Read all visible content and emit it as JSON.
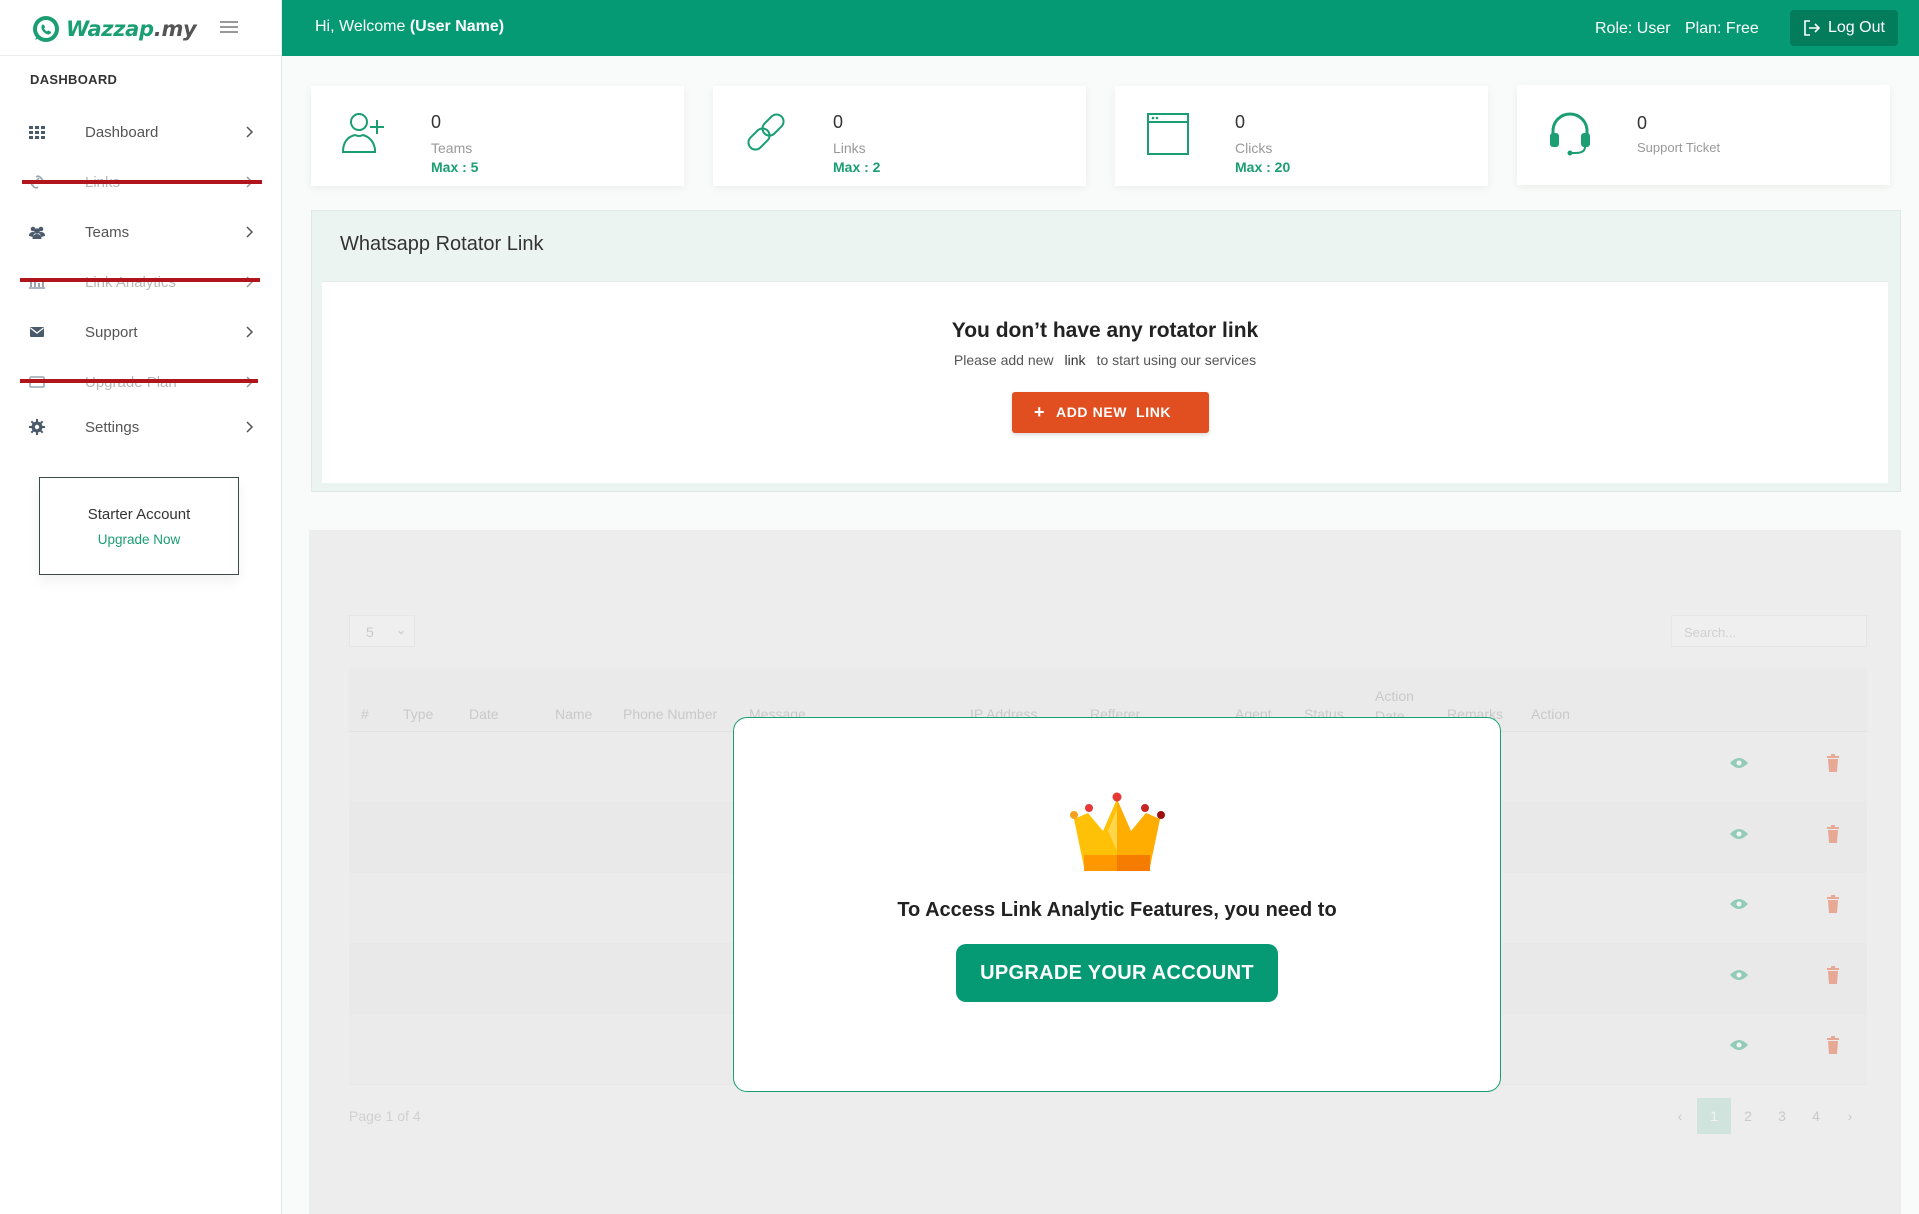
{
  "brand": {
    "logo_text": "Wazzap",
    "logo_suffix": ".my",
    "brand_color": "#1a9e72",
    "header_color": "#059a74"
  },
  "sidebar": {
    "heading": "DASHBOARD",
    "items": [
      {
        "label": "Dashboard",
        "icon": "grid-icon",
        "disabled": false
      },
      {
        "label": "Links",
        "icon": "link-icon",
        "disabled": true
      },
      {
        "label": "Teams",
        "icon": "users-icon",
        "disabled": false
      },
      {
        "label": "Link Analytics",
        "icon": "chart-icon",
        "disabled": true
      },
      {
        "label": "Support",
        "icon": "envelope-icon",
        "disabled": false
      },
      {
        "label": "Upgrade Plan",
        "icon": "card-icon",
        "disabled": true
      },
      {
        "label": "Settings",
        "icon": "gear-icon",
        "disabled": false
      }
    ],
    "plan_card": {
      "name": "Starter Account",
      "action": "Upgrade Now"
    }
  },
  "header": {
    "welcome_prefix": "Hi, Welcome ",
    "user_name": "(User Name)",
    "role": "Role: User",
    "plan": "Plan: Free",
    "logout": "Log Out"
  },
  "stats": [
    {
      "value": "0",
      "label": "Teams",
      "max": "Max : 5",
      "icon": "add-user-icon"
    },
    {
      "value": "0",
      "label": "Links",
      "max": "Max : 2",
      "icon": "chain-link-icon"
    },
    {
      "value": "0",
      "label": "Clicks",
      "max": "Max : 20",
      "icon": "browser-window-icon"
    },
    {
      "value": "0",
      "label": "Support Ticket",
      "max": "",
      "icon": "headset-icon"
    }
  ],
  "rotator": {
    "title": "Whatsapp Rotator Link",
    "empty_title": "You don’t have any rotator link",
    "empty_sub_prefix": "Please add new",
    "empty_sub_link": "link",
    "empty_sub_suffix": "to start using our services",
    "add_button": "ADD NEW  LINK"
  },
  "analytics": {
    "page_size": "5",
    "search_placeholder": "Search...",
    "columns": [
      "#",
      "Type",
      "Date",
      "Name",
      "Phone Number",
      "Message",
      "IP Address",
      "Refferer",
      "Agent",
      "Status",
      "Action Date",
      "Remarks",
      "Action"
    ],
    "row_count": 5,
    "page_info": "Page 1 of 4",
    "pages": [
      "1",
      "2",
      "3",
      "4"
    ],
    "current_page": "1"
  },
  "upgrade_modal": {
    "message": "To Access Link Analytic Features, you need to",
    "button": "UPGRADE YOUR ACCOUNT"
  }
}
